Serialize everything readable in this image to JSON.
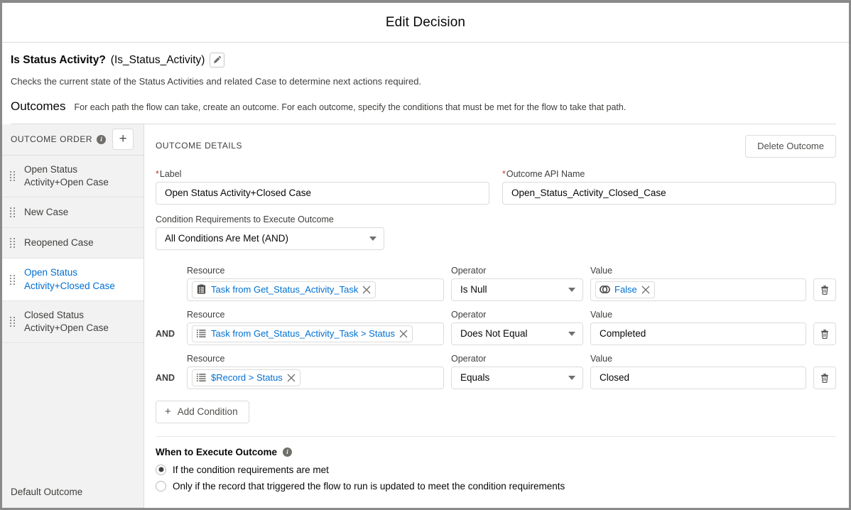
{
  "header": {
    "title": "Edit Decision"
  },
  "decision": {
    "label": "Is Status Activity?",
    "api_name": "(Is_Status_Activity)",
    "edit_icon": "pencil-icon",
    "description": "Checks the current state of the Status Activities and related Case to determine next actions required."
  },
  "outcomes_section": {
    "heading": "Outcomes",
    "help_text": "For each path the flow can take, create an outcome. For each outcome, specify the conditions that must be met for the flow to take that path."
  },
  "sidebar": {
    "title": "OUTCOME ORDER",
    "info_icon": "info-icon",
    "info_glyph": "i",
    "add_button_glyph": "+",
    "add_button_name": "add-outcome-button",
    "items": [
      {
        "label": "Open Status Activity+Open Case",
        "selected": false,
        "draggable": true
      },
      {
        "label": "New Case",
        "selected": false,
        "draggable": true
      },
      {
        "label": "Reopened Case",
        "selected": false,
        "draggable": true
      },
      {
        "label": "Open Status Activity+Closed Case",
        "selected": true,
        "draggable": true
      },
      {
        "label": "Closed Status Activity+Open Case",
        "selected": false,
        "draggable": true
      }
    ],
    "default_outcome": "Default Outcome"
  },
  "detail": {
    "title": "OUTCOME DETAILS",
    "delete_outcome_label": "Delete Outcome",
    "label_field": {
      "label": "Label",
      "required": true,
      "value": "Open Status Activity+Closed Case",
      "placeholder": ""
    },
    "api_name_field": {
      "label": "Outcome API Name",
      "required": true,
      "value": "Open_Status_Activity_Closed_Case",
      "placeholder": ""
    },
    "condition_requirements": {
      "label": "Condition Requirements to Execute Outcome",
      "value": "All Conditions Are Met (AND)"
    },
    "column_headers": {
      "resource": "Resource",
      "operator": "Operator",
      "value": "Value"
    },
    "conditions": [
      {
        "prefix": "",
        "resource": "Task from Get_Status_Activity_Task",
        "resource_icon": "record-icon",
        "operator": "Is Null",
        "value": "False",
        "value_is_pill": true,
        "value_icon": "boolean-icon"
      },
      {
        "prefix": "AND",
        "resource": "Task from Get_Status_Activity_Task > Status",
        "resource_icon": "picklist-icon",
        "operator": "Does Not Equal",
        "value": "Completed",
        "value_is_pill": false,
        "value_icon": ""
      },
      {
        "prefix": "AND",
        "resource": "$Record > Status",
        "resource_icon": "picklist-icon",
        "operator": "Equals",
        "value": "Closed",
        "value_is_pill": false,
        "value_icon": ""
      }
    ],
    "add_condition_label": "Add Condition",
    "add_condition_glyph": "+",
    "when_to_execute": {
      "title": "When to Execute Outcome",
      "info_glyph": "i",
      "options": [
        {
          "label": "If the condition requirements are met",
          "checked": true
        },
        {
          "label": "Only if the record that triggered the flow to run is updated to meet the condition requirements",
          "checked": false
        }
      ]
    }
  },
  "colors": {
    "link_blue": "#0070d2",
    "required_red": "#c23934",
    "sidebar_bg": "#f3f2f2",
    "border": "#dddbda"
  }
}
